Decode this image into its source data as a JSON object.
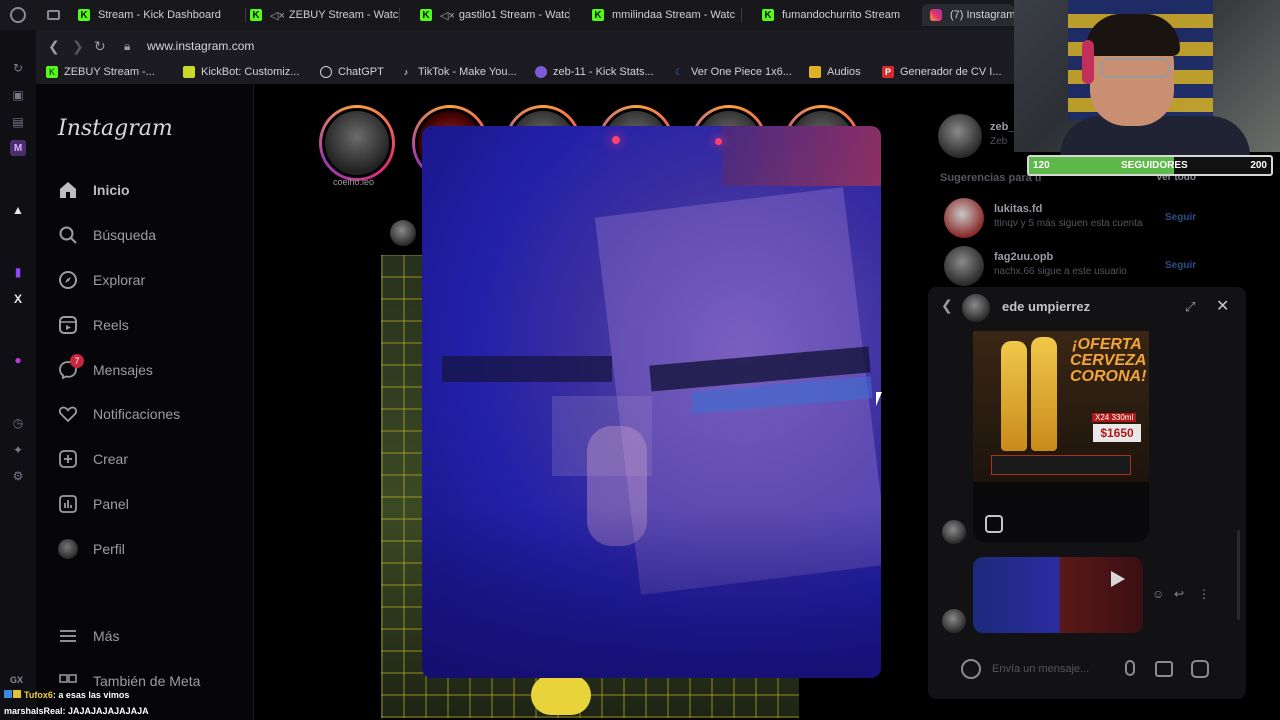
{
  "browser": {
    "tabs": [
      {
        "label": "Stream - Kick Dashboard",
        "type": "kick"
      },
      {
        "label": "ZEBUY Stream - Watc",
        "type": "kick-muted"
      },
      {
        "label": "gastilo1 Stream - Watc",
        "type": "kick-muted"
      },
      {
        "label": "mmilindaa Stream - Watc",
        "type": "kick"
      },
      {
        "label": "fumandochurrito Stream",
        "type": "kick"
      },
      {
        "label": "(7) Instagram",
        "type": "instagram",
        "active": true
      }
    ],
    "url": "www.instagram.com",
    "bookmarks": [
      {
        "label": "ZEBUY Stream -...",
        "color": "#53fc18"
      },
      {
        "label": "KickBot: Customiz...",
        "color": "#c9d92a"
      },
      {
        "label": "ChatGPT",
        "color": "#d0d0d0"
      },
      {
        "label": "TikTok - Make You...",
        "color": "#101010"
      },
      {
        "label": "zeb-11 - Kick Stats...",
        "color": "#7b5cd6"
      },
      {
        "label": "Ver One Piece 1x6...",
        "color": "#2b6fd6"
      },
      {
        "label": "Audios",
        "color": "#e2b026"
      },
      {
        "label": "Generador de CV I...",
        "color": "#d62b2b"
      }
    ],
    "sidebar_label": "GX"
  },
  "instagram": {
    "logo": "Instagram",
    "nav": [
      {
        "label": "Inicio",
        "icon": "home-icon"
      },
      {
        "label": "Búsqueda",
        "icon": "search-icon"
      },
      {
        "label": "Explorar",
        "icon": "compass-icon"
      },
      {
        "label": "Reels",
        "icon": "reels-icon"
      },
      {
        "label": "Mensajes",
        "icon": "messenger-icon",
        "badge": "7"
      },
      {
        "label": "Notificaciones",
        "icon": "heart-icon"
      },
      {
        "label": "Crear",
        "icon": "plus-square-icon"
      },
      {
        "label": "Panel",
        "icon": "chart-icon"
      },
      {
        "label": "Perfil",
        "icon": "profile-avatar"
      }
    ],
    "more": "Más",
    "meta": "También de Meta",
    "story_first_user": "coelho.leo",
    "right": {
      "username": "zeb_",
      "subname": "Zeb",
      "suggestions_title": "Sugerencias para ti",
      "see_all": "Ver todo",
      "suggestions": [
        {
          "name": "lukitas.fd",
          "sub": "ttinqv y 5 más siguen esta cuenta",
          "action": "Seguir"
        },
        {
          "name": "fag2uu.opb",
          "sub": "nachx.66 sigue a este usuario",
          "action": "Seguir"
        }
      ]
    },
    "chat": {
      "title": "ede umpierrez",
      "promo_title": "¡OFERTA CERVEZA CORONA!",
      "promo_size": "X24 330ml",
      "promo_price": "$1650",
      "input_placeholder": "Envía un mensaje..."
    }
  },
  "overlay": {
    "followers": {
      "current": "120",
      "label": "SEGUIDORES",
      "goal": "200",
      "progress": 0.6
    },
    "chat_messages": [
      {
        "user": "Tufox6",
        "text": ": a esas las vimos",
        "color": "#f2d23a"
      },
      {
        "user": "marshalsReal",
        "text": ": JAJAJAJAJAJAJA",
        "color": "#ffffff"
      }
    ]
  }
}
